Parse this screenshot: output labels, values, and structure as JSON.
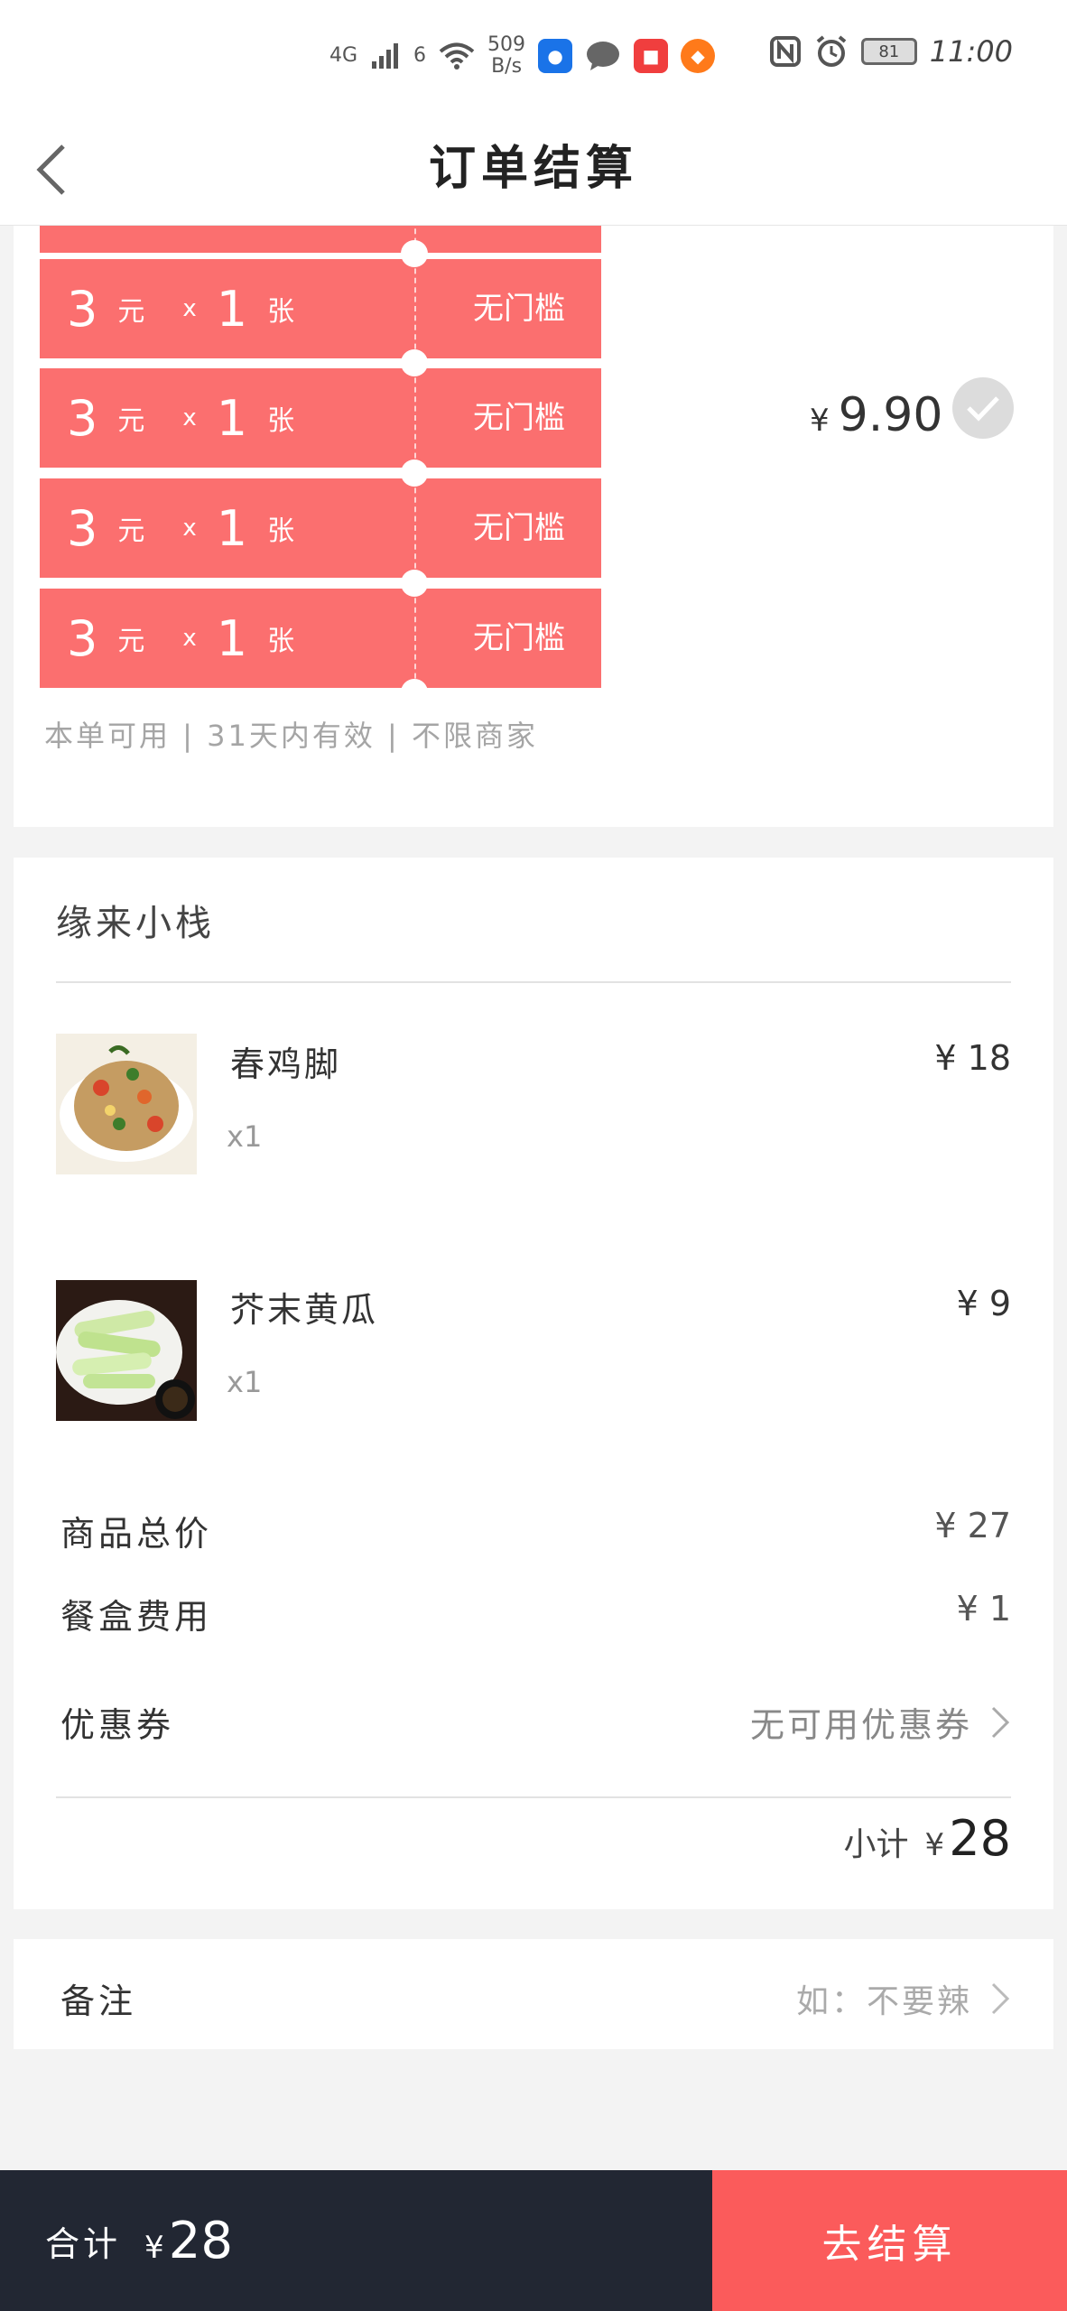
{
  "status_bar": {
    "network_speed": "509",
    "network_unit": "B/s",
    "signal_1": "4G",
    "signal_2": "6",
    "battery": "81",
    "time": "11:00"
  },
  "header": {
    "title": "订单结算"
  },
  "coupons": {
    "tickets": [
      {
        "amount": "3",
        "unit": "元",
        "times": "x",
        "count": "1",
        "count_unit": "张",
        "condition": "无门槛"
      },
      {
        "amount": "3",
        "unit": "元",
        "times": "x",
        "count": "1",
        "count_unit": "张",
        "condition": "无门槛"
      },
      {
        "amount": "3",
        "unit": "元",
        "times": "x",
        "count": "1",
        "count_unit": "张",
        "condition": "无门槛"
      },
      {
        "amount": "3",
        "unit": "元",
        "times": "x",
        "count": "1",
        "count_unit": "张",
        "condition": "无门槛"
      }
    ],
    "price_symbol": "¥",
    "price": "9.90",
    "note": "本单可用 | 31天内有效 | 不限商家"
  },
  "order": {
    "shop_name": "缘来小栈",
    "items": [
      {
        "name": "春鸡脚",
        "qty": "x1",
        "price": "¥ 18"
      },
      {
        "name": "芥末黄瓜",
        "qty": "x1",
        "price": "¥ 9"
      }
    ],
    "goods_total_label": "商品总价",
    "goods_total_value": "¥ 27",
    "box_fee_label": "餐盒费用",
    "box_fee_value": "¥ 1",
    "coupon_label": "优惠券",
    "coupon_value": "无可用优惠券",
    "subtotal_label": "小计",
    "subtotal_symbol": "¥",
    "subtotal_value": "28"
  },
  "remark": {
    "label": "备注",
    "placeholder": "如：不要辣"
  },
  "footer": {
    "total_label": "合计",
    "total_symbol": "¥",
    "total_value": "28",
    "checkout_label": "去结算"
  },
  "colors": {
    "ticket_red": "#fb6f6f",
    "checkout_red": "#fb5b5b",
    "footer_dark": "#222733"
  }
}
